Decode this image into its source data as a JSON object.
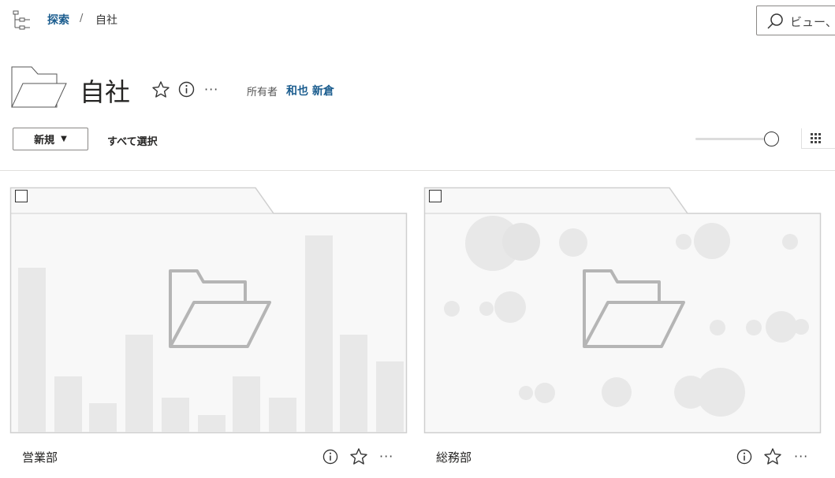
{
  "breadcrumb": {
    "root": "探索",
    "separator": "/",
    "current": "自社"
  },
  "search": {
    "placeholder": "ビュー、"
  },
  "header": {
    "title": "自社",
    "owner_label": "所有者",
    "owner_name": "和也 新倉",
    "more": "···"
  },
  "toolbar": {
    "new_label": "新規",
    "new_caret": "▼",
    "select_all_label": "すべて選択",
    "zoom_slider_value": 1.0
  },
  "cards": [
    {
      "name": "営業部",
      "thumbnail": "bar-chart",
      "checked": false,
      "more": "···"
    },
    {
      "name": "総務部",
      "thumbnail": "bubble-chart",
      "checked": false,
      "more": "···"
    }
  ],
  "colors": {
    "link": "#1a5c8e",
    "card_bg": "#f8f8f8",
    "thumb_gray": "#e8e8e8",
    "folder_icon_gray": "#b5b5b5"
  },
  "icons": {
    "tree": "tree-icon",
    "search": "search-icon",
    "folder": "folder-icon",
    "star": "star-icon",
    "info": "info-icon",
    "more": "more-icon",
    "grid": "grid-view-icon",
    "checkbox": "checkbox-icon"
  }
}
